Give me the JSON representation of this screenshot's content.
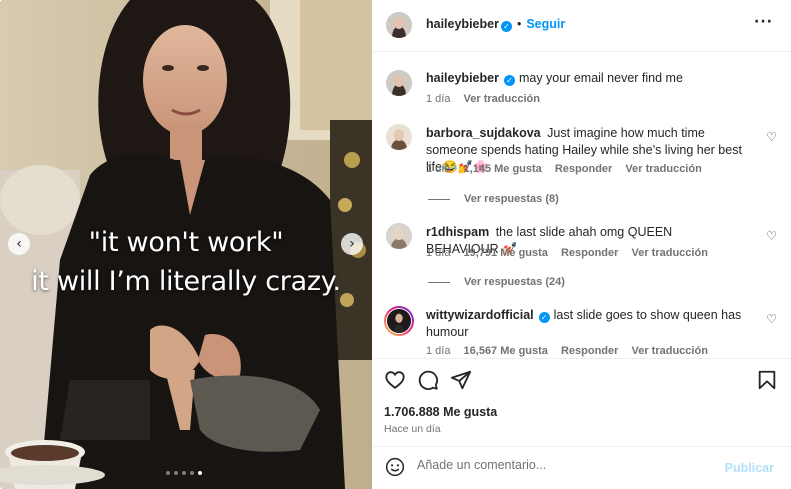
{
  "media": {
    "caption_line1": "\"it won't work\"",
    "caption_line2": "it will I’m literally crazy.",
    "prev_arrow": "‹",
    "next_arrow": "›",
    "slide_count": 5,
    "active_slide": 5
  },
  "header": {
    "username": "haileybieber",
    "separator": "•",
    "follow_label": "Seguir",
    "more_label": "···"
  },
  "caption": {
    "username": "haileybieber",
    "text": "may your email never find me",
    "time": "1 día",
    "translate": "Ver traducción"
  },
  "comments": [
    {
      "username": "barbora_sujdakova",
      "verified": false,
      "text": "Just imagine how much time someone spends hating Hailey while she’s living her best life😂💅🌸",
      "time": "1 día",
      "likes": "1,145 Me gusta",
      "reply": "Responder",
      "translate": "Ver traducción",
      "replies": "Ver respuestas (8)"
    },
    {
      "username": "r1dhispam",
      "verified": false,
      "text": "the last slide ahah omg QUEEN BEHAVIOUR 💅🏻",
      "time": "1 día",
      "likes": "19,791 Me gusta",
      "reply": "Responder",
      "translate": "Ver traducción",
      "replies": "Ver respuestas (24)"
    },
    {
      "username": "wittywizardofficial",
      "verified": true,
      "text": "last slide goes to show queen has humour",
      "time": "1 día",
      "likes": "16,567 Me gusta",
      "reply": "Responder",
      "translate": "Ver traducción"
    }
  ],
  "actions": {
    "likes": "1.706.888 Me gusta",
    "time": "Hace un día"
  },
  "composer": {
    "placeholder": "Añade un comentario...",
    "publish_label": "Publicar"
  },
  "icons": {
    "like": "heart-icon",
    "comment": "comment-icon",
    "share": "share-icon",
    "save": "bookmark-icon",
    "emoji": "emoji-icon",
    "verified": "verified-badge-icon"
  },
  "colors": {
    "accent": "#0095f6",
    "publish_disabled": "#b2dffc",
    "muted": "#737373"
  }
}
